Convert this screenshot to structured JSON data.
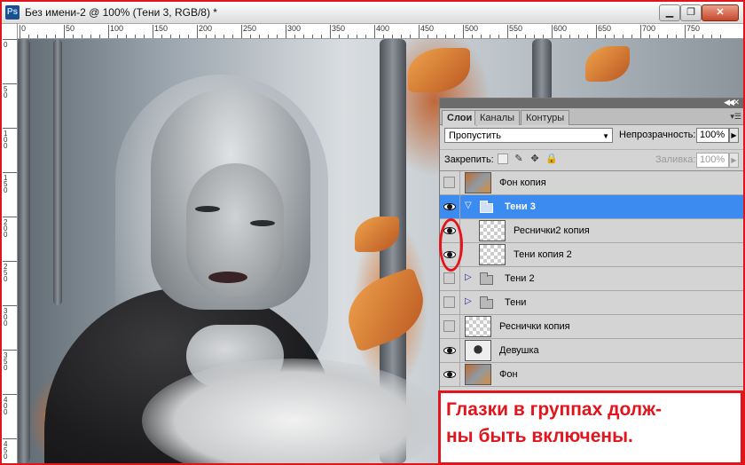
{
  "window": {
    "app_icon": "Ps",
    "title": "Без имени-2 @ 100% (Тени 3, RGB/8) *",
    "controls": [
      "minimize-icon",
      "restore-icon",
      "close-icon"
    ]
  },
  "ruler": {
    "top_labels": [
      "0",
      "50",
      "100",
      "150",
      "200",
      "250",
      "300",
      "350",
      "400",
      "450",
      "500",
      "550",
      "600",
      "650",
      "700",
      "750"
    ],
    "left_labels": [
      "0",
      "50",
      "100",
      "150",
      "200",
      "250",
      "300",
      "350",
      "400",
      "450"
    ]
  },
  "layers_panel": {
    "tabs": [
      "Слои",
      "Каналы",
      "Контуры"
    ],
    "active_tab": "Слои",
    "blend_mode": "Пропустить",
    "opacity_label": "Непрозрачность:",
    "opacity_value": "100%",
    "lock_label": "Закрепить:",
    "fill_label": "Заливка:",
    "fill_value": "100%",
    "layers": [
      {
        "name": "Фон копия",
        "type": "layer",
        "visible": false,
        "thumb": "photo"
      },
      {
        "name": "Тени 3",
        "type": "group",
        "visible": true,
        "expanded": true,
        "selected": true
      },
      {
        "name": "Реснички2 копия",
        "type": "layer",
        "visible": true,
        "thumb": "transparent",
        "indent": true
      },
      {
        "name": "Тени копия 2",
        "type": "layer",
        "visible": true,
        "thumb": "transparent",
        "indent": true
      },
      {
        "name": "Тени 2",
        "type": "group",
        "visible": false,
        "expanded": false
      },
      {
        "name": "Тени",
        "type": "group",
        "visible": false,
        "expanded": false
      },
      {
        "name": "Реснички копия",
        "type": "layer",
        "visible": false,
        "thumb": "transparent"
      },
      {
        "name": "Девушка",
        "type": "layer",
        "visible": true,
        "thumb": "girl"
      },
      {
        "name": "Фон",
        "type": "layer",
        "visible": true,
        "thumb": "photo"
      }
    ]
  },
  "annotation": {
    "text": "Глазки в группах долж-ны быть включены.",
    "line1": "Глазки в группах долж-",
    "line2": "ны быть включены.",
    "color": "#e2141c"
  }
}
